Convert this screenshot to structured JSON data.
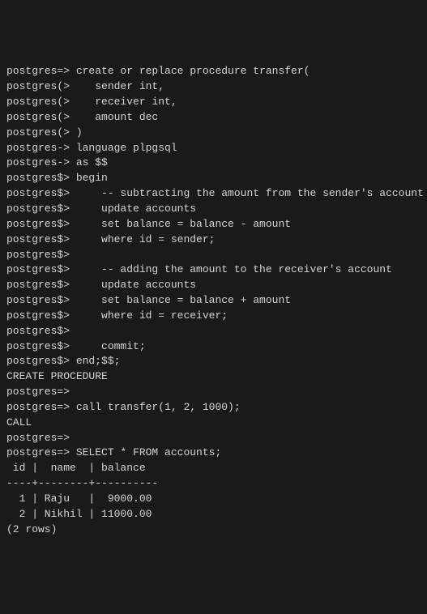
{
  "lines": [
    {
      "prompt": "postgres=>",
      "text": " create or replace procedure transfer("
    },
    {
      "prompt": "postgres(>",
      "text": "    sender int,"
    },
    {
      "prompt": "postgres(>",
      "text": "    receiver int,"
    },
    {
      "prompt": "postgres(>",
      "text": "    amount dec"
    },
    {
      "prompt": "postgres(>",
      "text": " )"
    },
    {
      "prompt": "postgres->",
      "text": " language plpgsql"
    },
    {
      "prompt": "postgres->",
      "text": " as $$"
    },
    {
      "prompt": "postgres$>",
      "text": " begin"
    },
    {
      "prompt": "postgres$>",
      "text": "     -- subtracting the amount from the sender's account"
    },
    {
      "prompt": "postgres$>",
      "text": "     update accounts"
    },
    {
      "prompt": "postgres$>",
      "text": "     set balance = balance - amount"
    },
    {
      "prompt": "postgres$>",
      "text": "     where id = sender;"
    },
    {
      "prompt": "postgres$>",
      "text": ""
    },
    {
      "prompt": "postgres$>",
      "text": "     -- adding the amount to the receiver's account"
    },
    {
      "prompt": "postgres$>",
      "text": "     update accounts"
    },
    {
      "prompt": "postgres$>",
      "text": "     set balance = balance + amount"
    },
    {
      "prompt": "postgres$>",
      "text": "     where id = receiver;"
    },
    {
      "prompt": "postgres$>",
      "text": ""
    },
    {
      "prompt": "postgres$>",
      "text": "     commit;"
    },
    {
      "prompt": "postgres$>",
      "text": " end;$$;"
    },
    {
      "prompt": "",
      "text": "CREATE PROCEDURE"
    },
    {
      "prompt": "postgres=>",
      "text": ""
    },
    {
      "prompt": "postgres=>",
      "text": " call transfer(1, 2, 1000);"
    },
    {
      "prompt": "",
      "text": "CALL"
    },
    {
      "prompt": "postgres=>",
      "text": ""
    },
    {
      "prompt": "postgres=>",
      "text": " SELECT * FROM accounts;"
    },
    {
      "prompt": "",
      "text": " id |  name  | balance"
    },
    {
      "prompt": "",
      "text": "----+--------+----------"
    },
    {
      "prompt": "",
      "text": "  1 | Raju   |  9000.00"
    },
    {
      "prompt": "",
      "text": "  2 | Nikhil | 11000.00"
    },
    {
      "prompt": "",
      "text": "(2 rows)"
    }
  ]
}
